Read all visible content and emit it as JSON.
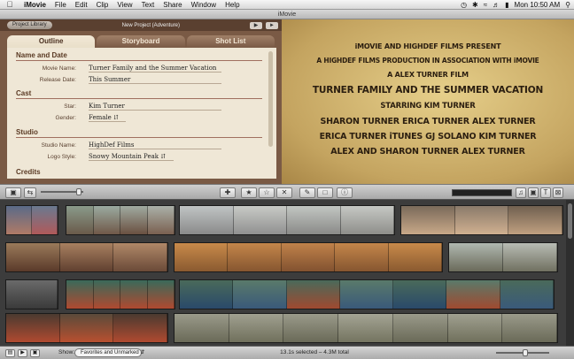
{
  "menubar": {
    "app": "iMovie",
    "items": [
      "File",
      "Edit",
      "Clip",
      "View",
      "Text",
      "Share",
      "Window",
      "Help"
    ],
    "clock": "Mon 10:50 AM"
  },
  "window_title": "iMovie",
  "project": {
    "library_button": "Project Library",
    "title": "New Project (Adventure)"
  },
  "tabs": [
    "Outline",
    "Storyboard",
    "Shot List"
  ],
  "outline": {
    "name_and_date": {
      "heading": "Name and Date",
      "movie_name_label": "Movie Name:",
      "movie_name": "Turner Family and the Summer Vacation",
      "release_date_label": "Release Date:",
      "release_date": "This Summer"
    },
    "cast": {
      "heading": "Cast",
      "star_label": "Star:",
      "star": "Kim Turner",
      "gender_label": "Gender:",
      "gender": "Female"
    },
    "studio": {
      "heading": "Studio",
      "studio_name_label": "Studio Name:",
      "studio_name": "HighDef Films",
      "logo_style_label": "Logo Style:",
      "logo_style": "Snowy Mountain Peak"
    },
    "credits": {
      "heading": "Credits"
    }
  },
  "viewer_credits": [
    "iMOVIE AND HIGHDEF FILMS PRESENT",
    "A HIGHDEF FILMS PRODUCTION IN ASSOCIATION WITH iMOVIE",
    "A ALEX TURNER FILM",
    "TURNER FAMILY AND THE SUMMER VACATION",
    "STARRING KIM TURNER",
    "SHARON TURNER  ERICA TURNER  ALEX TURNER",
    "ERICA TURNER  iTUNES  GJ SOLANO  KIM TURNER",
    "ALEX AND SHARON TURNER  ALEX TURNER"
  ],
  "colors": {
    "viewer_bg": "#d8bd74",
    "panel_bg": "#7a5a45",
    "sheet_bg": "#efe7d6"
  },
  "bottombar": {
    "show_label": "Show:",
    "filter": "Favorites and Unmarked",
    "status": "13.1s selected – 4.3M total"
  }
}
